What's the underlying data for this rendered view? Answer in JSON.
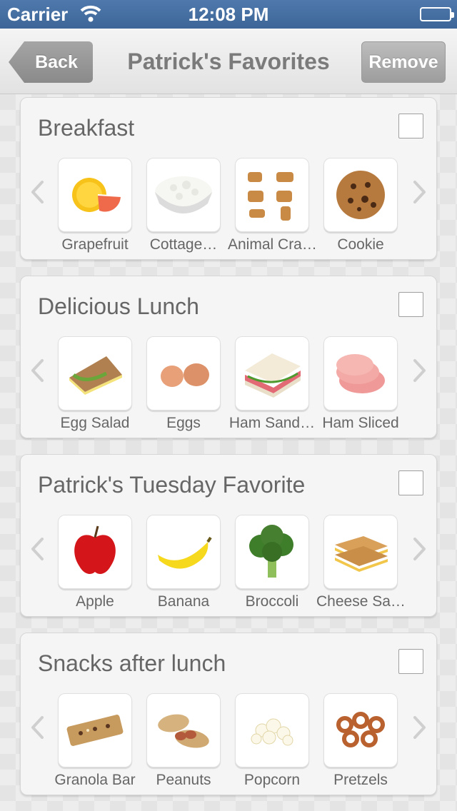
{
  "status_bar": {
    "carrier": "Carrier",
    "time": "12:08 PM"
  },
  "nav": {
    "back_label": "Back",
    "title": "Patrick's Favorites",
    "remove_label": "Remove"
  },
  "groups": [
    {
      "title": "Breakfast",
      "items": [
        {
          "label": "Grapefruit",
          "icon": "grapefruit-icon"
        },
        {
          "label": "Cottage…",
          "icon": "cottage-cheese-icon"
        },
        {
          "label": "Animal Cra…",
          "icon": "animal-crackers-icon"
        },
        {
          "label": "Cookie",
          "icon": "cookie-icon"
        }
      ]
    },
    {
      "title": "Delicious Lunch",
      "items": [
        {
          "label": "Egg Salad",
          "icon": "egg-salad-sandwich-icon"
        },
        {
          "label": "Eggs",
          "icon": "eggs-icon"
        },
        {
          "label": "Ham Sand…",
          "icon": "ham-sandwich-icon"
        },
        {
          "label": "Ham Sliced",
          "icon": "ham-sliced-icon"
        }
      ]
    },
    {
      "title": "Patrick's Tuesday Favorite",
      "items": [
        {
          "label": "Apple",
          "icon": "apple-icon"
        },
        {
          "label": "Banana",
          "icon": "banana-icon"
        },
        {
          "label": "Broccoli",
          "icon": "broccoli-icon"
        },
        {
          "label": "Cheese Sa…",
          "icon": "cheese-sandwich-icon"
        }
      ]
    },
    {
      "title": "Snacks after lunch",
      "items": [
        {
          "label": "Granola Bar",
          "icon": "granola-bar-icon"
        },
        {
          "label": "Peanuts",
          "icon": "peanuts-icon"
        },
        {
          "label": "Popcorn",
          "icon": "popcorn-icon"
        },
        {
          "label": "Pretzels",
          "icon": "pretzels-icon"
        }
      ]
    }
  ]
}
